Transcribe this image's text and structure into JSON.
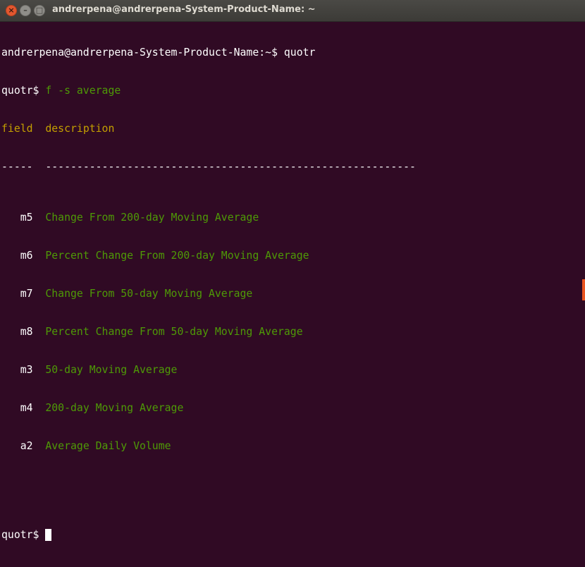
{
  "window": {
    "title": "andrerpena@andrerpena-System-Product-Name: ~",
    "close_glyph": "×",
    "minimize_glyph": "–",
    "maximize_glyph": "□"
  },
  "terminal": {
    "line1": "andrerpena@andrerpena-System-Product-Name:~$ quotr",
    "prompt": "quotr$",
    "command": " f -s average",
    "header_field": "field",
    "header_description": "  description",
    "sep_field": "-----",
    "sep_description": "  -----------------------------------------------------------",
    "rows": [
      {
        "field": "   m5",
        "description": "  Change From 200-day Moving Average"
      },
      {
        "field": "   m6",
        "description": "  Percent Change From 200-day Moving Average"
      },
      {
        "field": "   m7",
        "description": "  Change From 50-day Moving Average"
      },
      {
        "field": "   m8",
        "description": "  Percent Change From 50-day Moving Average"
      },
      {
        "field": "   m3",
        "description": "  50-day Moving Average"
      },
      {
        "field": "   m4",
        "description": "  200-day Moving Average"
      },
      {
        "field": "   a2",
        "description": "  Average Daily Volume"
      }
    ],
    "final_prompt": "quotr$ "
  },
  "colors": {
    "background": "#300a24",
    "green": "#4e9a06",
    "yellow": "#c4a000",
    "accent": "#e95420"
  }
}
